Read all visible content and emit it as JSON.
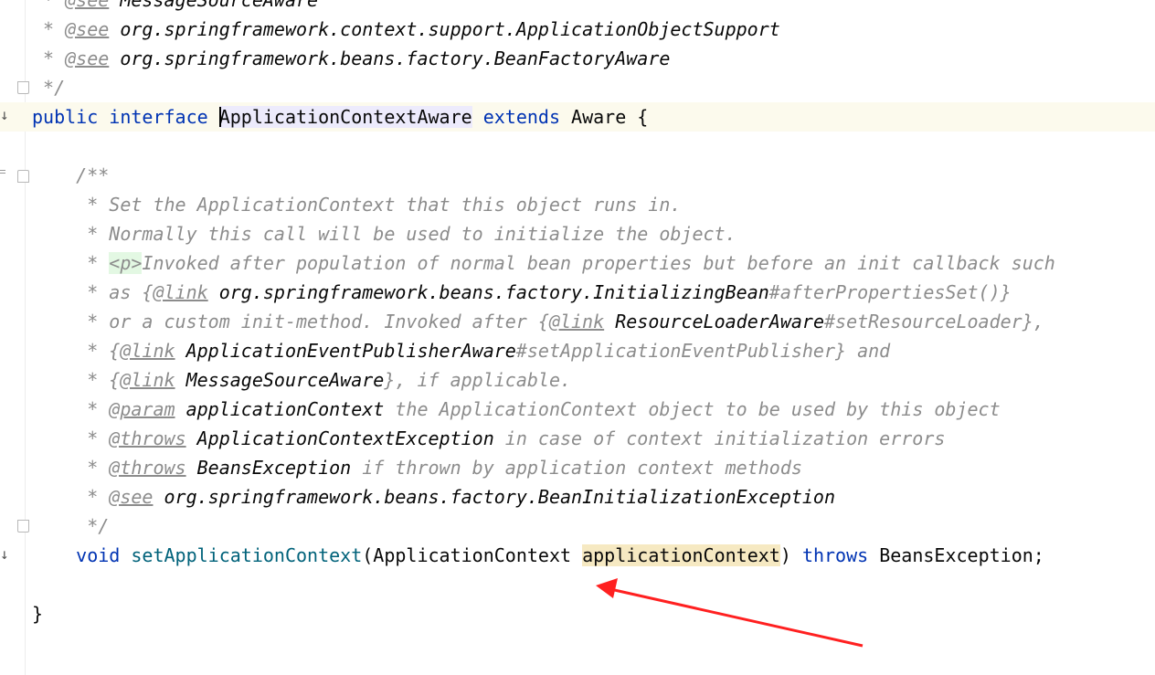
{
  "lines": [
    {
      "segs": [
        {
          "c": "doc",
          "t": " * "
        },
        {
          "c": "doc-tag",
          "t": "@see"
        },
        {
          "c": "doc",
          "t": " "
        },
        {
          "c": "doc-ref",
          "t": "MessageSourceAware"
        }
      ]
    },
    {
      "segs": [
        {
          "c": "doc",
          "t": " * "
        },
        {
          "c": "doc-tag",
          "t": "@see"
        },
        {
          "c": "doc",
          "t": " "
        },
        {
          "c": "doc-ref",
          "t": "org.springframework.context.support.ApplicationObjectSupport"
        }
      ]
    },
    {
      "segs": [
        {
          "c": "doc",
          "t": " * "
        },
        {
          "c": "doc-tag",
          "t": "@see"
        },
        {
          "c": "doc",
          "t": " "
        },
        {
          "c": "doc-ref",
          "t": "org.springframework.beans.factory.BeanFactoryAware"
        }
      ]
    },
    {
      "segs": [
        {
          "c": "doc",
          "t": " */"
        }
      ]
    },
    {
      "segs": [
        {
          "c": "kw",
          "t": "public"
        },
        {
          "c": "plain",
          "t": " "
        },
        {
          "c": "kw",
          "t": "interface"
        },
        {
          "c": "plain",
          "t": " "
        },
        {
          "c": "caret",
          "t": ""
        },
        {
          "c": "plain sel-word",
          "t": "ApplicationContextAware"
        },
        {
          "c": "plain",
          "t": " "
        },
        {
          "c": "kw",
          "t": "extends"
        },
        {
          "c": "plain",
          "t": " Aware {"
        }
      ]
    },
    {
      "segs": []
    },
    {
      "segs": [
        {
          "c": "doc",
          "t": "    /**"
        }
      ]
    },
    {
      "segs": [
        {
          "c": "doc",
          "t": "     * Set the ApplicationContext that this object runs in."
        }
      ]
    },
    {
      "segs": [
        {
          "c": "doc",
          "t": "     * Normally this call will be used to initialize the object."
        }
      ]
    },
    {
      "segs": [
        {
          "c": "doc",
          "t": "     * "
        },
        {
          "c": "doc-html",
          "t": "<p>"
        },
        {
          "c": "doc",
          "t": "Invoked after population of normal bean properties but before an init callback such"
        }
      ]
    },
    {
      "segs": [
        {
          "c": "doc",
          "t": "     * as {"
        },
        {
          "c": "doc-tag",
          "t": "@link"
        },
        {
          "c": "doc",
          "t": " "
        },
        {
          "c": "doc-ref",
          "t": "org.springframework.beans.factory.InitializingBean"
        },
        {
          "c": "doc",
          "t": "#afterPropertiesSet()}"
        }
      ]
    },
    {
      "segs": [
        {
          "c": "doc",
          "t": "     * or a custom init-method. Invoked after {"
        },
        {
          "c": "doc-tag",
          "t": "@link"
        },
        {
          "c": "doc",
          "t": " "
        },
        {
          "c": "doc-ref",
          "t": "ResourceLoaderAware"
        },
        {
          "c": "doc",
          "t": "#setResourceLoader},"
        }
      ]
    },
    {
      "segs": [
        {
          "c": "doc",
          "t": "     * {"
        },
        {
          "c": "doc-tag",
          "t": "@link"
        },
        {
          "c": "doc",
          "t": " "
        },
        {
          "c": "doc-ref",
          "t": "ApplicationEventPublisherAware"
        },
        {
          "c": "doc",
          "t": "#setApplicationEventPublisher} and"
        }
      ]
    },
    {
      "segs": [
        {
          "c": "doc",
          "t": "     * {"
        },
        {
          "c": "doc-tag",
          "t": "@link"
        },
        {
          "c": "doc",
          "t": " "
        },
        {
          "c": "doc-ref",
          "t": "MessageSourceAware"
        },
        {
          "c": "doc",
          "t": "}, if applicable."
        }
      ]
    },
    {
      "segs": [
        {
          "c": "doc",
          "t": "     * "
        },
        {
          "c": "doc-tag",
          "t": "@param"
        },
        {
          "c": "doc",
          "t": " "
        },
        {
          "c": "doc-ref",
          "t": "applicationContext"
        },
        {
          "c": "doc",
          "t": " the ApplicationContext object to be used by this object"
        }
      ]
    },
    {
      "segs": [
        {
          "c": "doc",
          "t": "     * "
        },
        {
          "c": "doc-tag",
          "t": "@throws"
        },
        {
          "c": "doc",
          "t": " "
        },
        {
          "c": "doc-ref",
          "t": "ApplicationContextException"
        },
        {
          "c": "doc",
          "t": " in case of context initialization errors"
        }
      ]
    },
    {
      "segs": [
        {
          "c": "doc",
          "t": "     * "
        },
        {
          "c": "doc-tag",
          "t": "@throws"
        },
        {
          "c": "doc",
          "t": " "
        },
        {
          "c": "doc-ref",
          "t": "BeansException"
        },
        {
          "c": "doc",
          "t": " if thrown by application context methods"
        }
      ]
    },
    {
      "segs": [
        {
          "c": "doc",
          "t": "     * "
        },
        {
          "c": "doc-tag",
          "t": "@see"
        },
        {
          "c": "doc",
          "t": " "
        },
        {
          "c": "doc-ref",
          "t": "org.springframework.beans.factory.BeanInitializationException"
        }
      ]
    },
    {
      "segs": [
        {
          "c": "doc",
          "t": "     */"
        }
      ]
    },
    {
      "segs": [
        {
          "c": "plain",
          "t": "    "
        },
        {
          "c": "kw",
          "t": "void"
        },
        {
          "c": "plain",
          "t": " "
        },
        {
          "c": "meth",
          "t": "setApplicationContext"
        },
        {
          "c": "plain",
          "t": "(ApplicationContext "
        },
        {
          "c": "plain hl-word",
          "t": "applicationContext"
        },
        {
          "c": "plain",
          "t": ") "
        },
        {
          "c": "kw",
          "t": "throws"
        },
        {
          "c": "plain",
          "t": " BeansException;"
        }
      ]
    },
    {
      "segs": []
    },
    {
      "segs": [
        {
          "c": "plain",
          "t": "}"
        }
      ]
    }
  ],
  "colors": {
    "keyword": "#0033b3",
    "comment": "#8c8c8c",
    "method": "#00627a",
    "arrow": "#ff2020"
  }
}
